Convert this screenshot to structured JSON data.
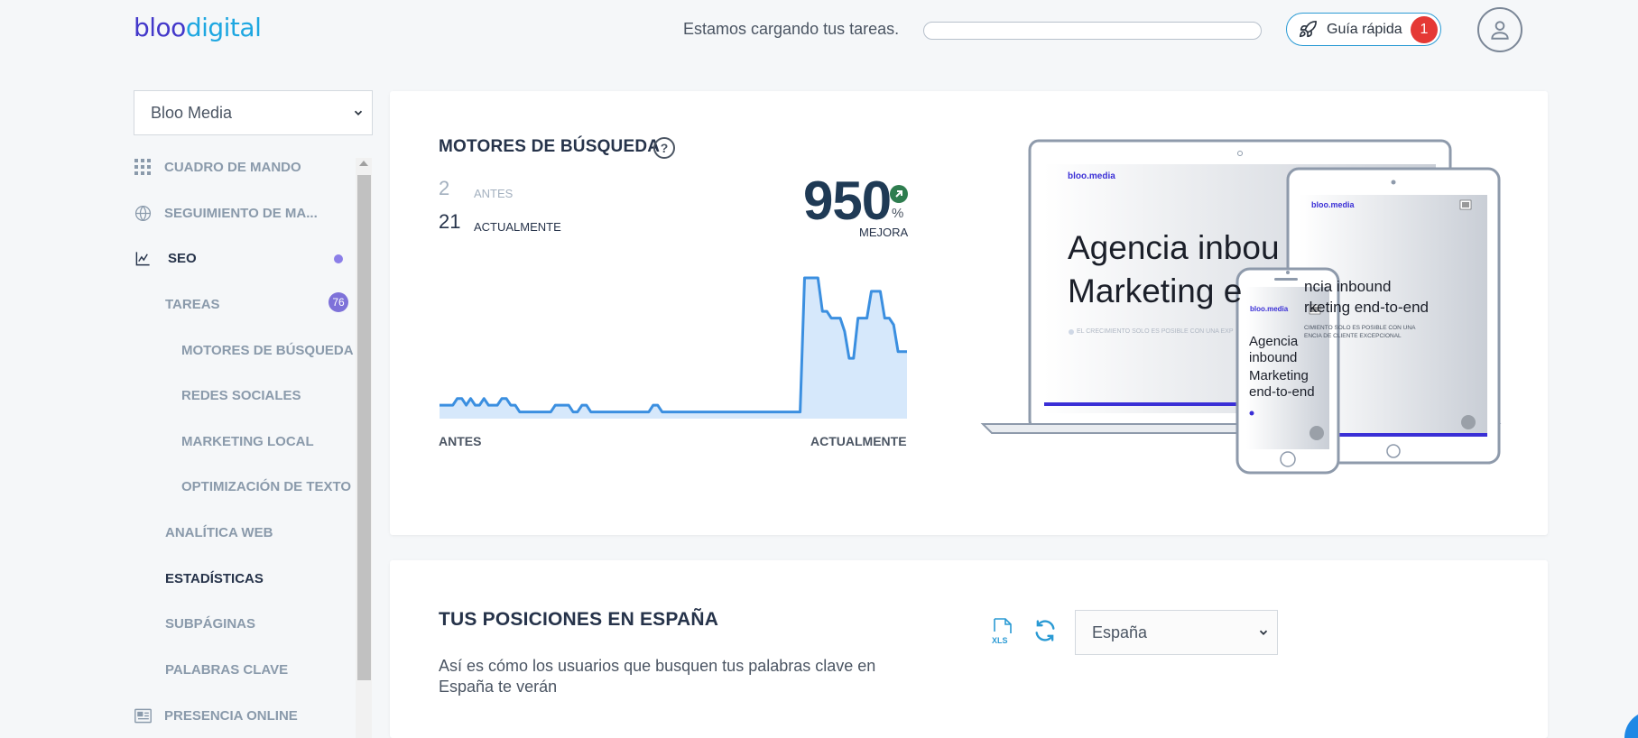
{
  "brand": {
    "part1": "bloo",
    "part2": "digital"
  },
  "header": {
    "loading_text": "Estamos cargando tus tareas.",
    "loading_progress": 0,
    "guide_label": "Guía rápida",
    "guide_badge": "1"
  },
  "sidebar": {
    "account": "Bloo Media",
    "items": [
      {
        "label": "CUADRO DE MANDO",
        "icon": "grid-icon"
      },
      {
        "label": "SEGUIMIENTO DE MA...",
        "icon": "globe-icon"
      },
      {
        "label": "SEO",
        "icon": "chart-line-icon"
      },
      {
        "label": "TAREAS",
        "badge": "76"
      },
      {
        "label": "MOTORES DE BÚSQUEDA"
      },
      {
        "label": "REDES SOCIALES"
      },
      {
        "label": "MARKETING LOCAL"
      },
      {
        "label": "OPTIMIZACIÓN DE TEXTO"
      },
      {
        "label": "ANALÍTICA WEB"
      },
      {
        "label": "ESTADÍSTICAS"
      },
      {
        "label": "SUBPÁGINAS"
      },
      {
        "label": "PALABRAS CLAVE"
      },
      {
        "label": "PRESENCIA ONLINE",
        "icon": "newspaper-icon"
      }
    ]
  },
  "search_engines": {
    "title": "MOTORES DE BÚSQUEDA",
    "before_value": "2",
    "before_label": "ANTES",
    "now_value": "21",
    "now_label": "ACTUALMENTE",
    "improvement": "950",
    "improvement_unit": "%",
    "improvement_label": "MEJORA",
    "x_left": "ANTES",
    "x_right": "ACTUALMENTE"
  },
  "chart_data": {
    "type": "area",
    "x_labels": [
      "ANTES",
      "ACTUALMENTE"
    ],
    "values": [
      2,
      2,
      2,
      2,
      3,
      3,
      2,
      3,
      2,
      2,
      3,
      2,
      2,
      2,
      3,
      3,
      2,
      2,
      1,
      1,
      1,
      1,
      1,
      1,
      1,
      1,
      2,
      2,
      2,
      2,
      1,
      1,
      2,
      2,
      1,
      1,
      1,
      1,
      1,
      1,
      1,
      1,
      1,
      1,
      1,
      1,
      1,
      1,
      2,
      2,
      1,
      1,
      1,
      1,
      1,
      1,
      1,
      1,
      1,
      1,
      1,
      1,
      1,
      1,
      1,
      1,
      1,
      1,
      1,
      1,
      1,
      1,
      1,
      1,
      1,
      1,
      1,
      1,
      1,
      1,
      1,
      1,
      21,
      21,
      21,
      21,
      16,
      16,
      15,
      15,
      15,
      13,
      9,
      9,
      15,
      15,
      15,
      19,
      19,
      19,
      15,
      15,
      14,
      10,
      10,
      10
    ],
    "color": "#3b8fe0",
    "fill": "#d6e8fb"
  },
  "mockup": {
    "brand": "bloo.media",
    "laptop_line1": "Agencia inbou",
    "laptop_line2": "Marketing e",
    "laptop_small": "EL CRECIMIENTO SOLO ES POSIBLE CON UNA EXP",
    "tablet_line1": "ncia inbound",
    "tablet_line2": "rketing end-to-end",
    "tablet_small1": "CIMIENTO SOLO ES POSIBLE CON UNA",
    "tablet_small2": "ENCIA DE CLIENTE EXCEPCIONAL",
    "phone_line1": "Agencia",
    "phone_line2": "inbound",
    "phone_line3": "Marketing",
    "phone_line4": "end-to-end"
  },
  "positions": {
    "title": "TUS POSICIONES EN ESPAÑA",
    "description": "Así es cómo los usuarios que busquen tus palabras clave en España te verán",
    "country": "España"
  },
  "colors": {
    "accent_blue": "#2a9ad4",
    "badge_red": "#e53935",
    "purple": "#7e72d9",
    "brand_indigo": "#4338ca",
    "positive_green": "#2e7d4f"
  }
}
